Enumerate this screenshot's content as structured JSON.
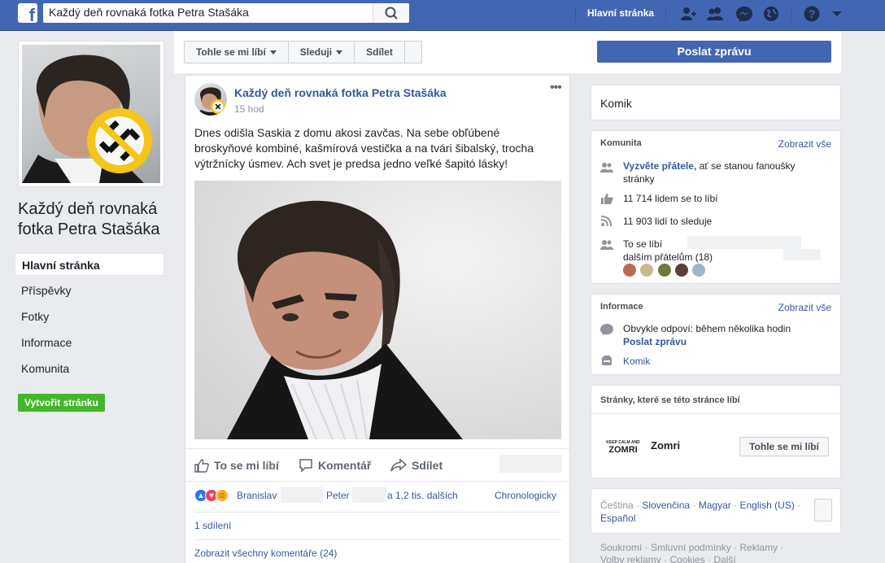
{
  "topbar": {
    "search_value": "Každý deň rovnaká fotka Petra Stašáka",
    "home_label": "Hlavní stránka",
    "icons": [
      "find-friends-icon",
      "friend-requests-icon",
      "messenger-icon",
      "notifications-globe-icon",
      "help-icon",
      "account-menu-caret-icon"
    ]
  },
  "page": {
    "name": "Každý deň rovnaká fotka Petra Stašáka"
  },
  "left_nav": {
    "items": [
      "Hlavní stránka",
      "Příspěvky",
      "Fotky",
      "Informace",
      "Komunita"
    ],
    "create_page": "Vytvořit stránku"
  },
  "action_bar": {
    "like": "Tohle se mi líbí",
    "follow": "Sleduji",
    "share": "Sdílet",
    "send_message": "Poslat zprávu"
  },
  "post": {
    "author": "Každý deň rovnaká fotka Petra Stašáka",
    "time": "15 hod",
    "more": "•••",
    "text": "Dnes odišla Saskia z domu akosi zavčas. Na sebe obľúbené broskyňové kombiné, kašmírová vestička a na tvári šibalský, trocha výtržnícky úsmev. Ach svet je predsa jedno veľké šapitó lásky!",
    "actions": {
      "like": "To se mi líbí",
      "comment": "Komentář",
      "share": "Sdílet"
    },
    "reactions": {
      "name1": "Branislav",
      "name2": "Peter",
      "others": "a 1,2 tis. dalších"
    },
    "sort": "Chronologicky",
    "shares": "1 sdílení",
    "view_comments": "Zobrazit všechny komentáře (24)"
  },
  "right": {
    "category": "Komik",
    "community": {
      "title": "Komunita",
      "see_all": "Zobrazit vše",
      "invite_link": "Vyzvěte přátele,",
      "invite_rest": " ať se stanou fanoušky stránky",
      "likes": "11 714 lidem se to líbí",
      "follows": "11 903 lidí to sleduje",
      "friends_like": "To se líbí",
      "friends_more": "dalším přátelům (18)"
    },
    "info": {
      "title": "Informace",
      "see_all": "Zobrazit vše",
      "response": "Obvykle odpoví: během několika hodin",
      "send_message": "Poslat zprávu",
      "category": "Komik"
    },
    "liked_pages": {
      "title": "Stránky, které se této stránce líbí",
      "page_name": "Zomri",
      "logo_small": "KEEP CALM AND",
      "logo_big": "ZOMRI",
      "like_button": "Tohle se mi líbí"
    },
    "languages": {
      "current": "Čeština",
      "items": [
        "Slovenčina",
        "Magyar",
        "English (US)",
        "Español"
      ]
    },
    "footer": {
      "line1": "Soukromí · Smluvní podmínky · Reklamy ·",
      "line2": "Volby reklamy · Cookies · Další"
    }
  },
  "colors": {
    "brand_blue": "#4267b2",
    "link_blue": "#365899",
    "create_green": "#42b72a",
    "background": "#e9ebee"
  }
}
